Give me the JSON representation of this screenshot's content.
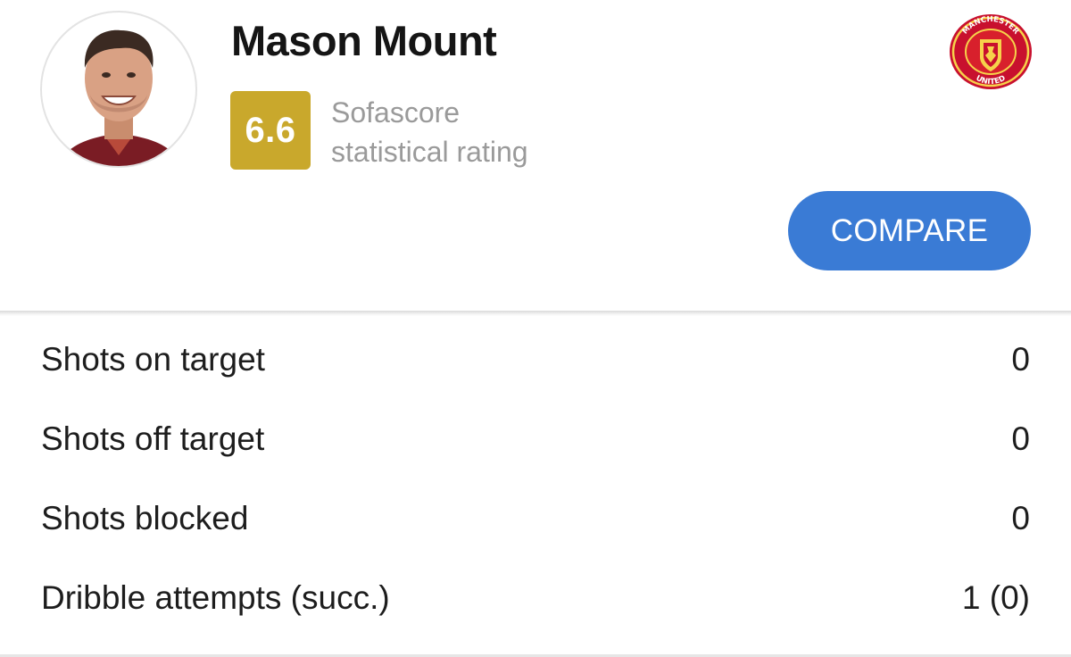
{
  "player": {
    "name": "Mason Mount",
    "rating": "6.6",
    "rating_caption_line1": "Sofascore",
    "rating_caption_line2": "statistical rating",
    "rating_color": "#c9a82c"
  },
  "club": {
    "logo_icon": "manchester-united-crest",
    "logo_text_top": "MANCHESTER",
    "logo_text_bottom": "UNITED"
  },
  "actions": {
    "compare_label": "COMPARE",
    "compare_color": "#3a7bd5"
  },
  "stats": [
    {
      "label": "Shots on target",
      "value": "0"
    },
    {
      "label": "Shots off target",
      "value": "0"
    },
    {
      "label": "Shots blocked",
      "value": "0"
    },
    {
      "label": "Dribble attempts (succ.)",
      "value": "1 (0)"
    }
  ]
}
